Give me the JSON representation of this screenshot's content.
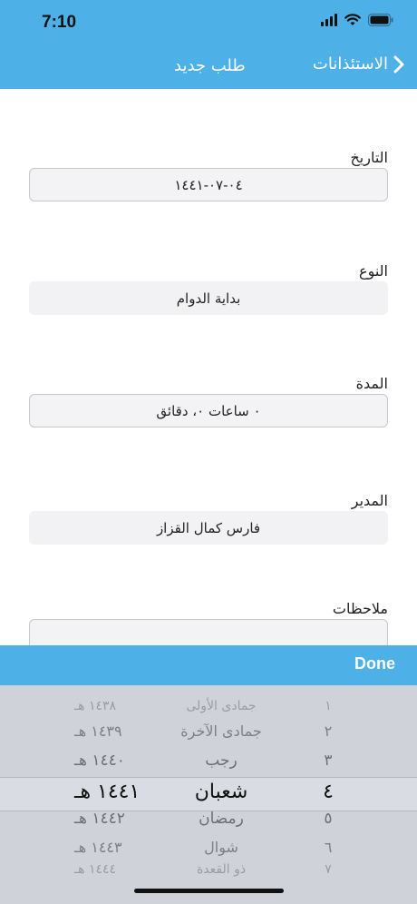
{
  "status": {
    "time": "7:10"
  },
  "nav": {
    "back_label": "الاستئذانات",
    "title": "طلب جديد"
  },
  "form": {
    "date_label": "التاريخ",
    "date_value": "٠٤-٠٧-١٤٤١",
    "type_label": "النوع",
    "type_value": "بداية الدوام",
    "duration_label": "المدة",
    "duration_value": "٠ ساعات ٠، دقائق",
    "manager_label": "المدير",
    "manager_value": "فارس كمال القزاز",
    "notes_label": "ملاحظات",
    "notes_value": ""
  },
  "picker": {
    "done_label": "Done",
    "rows": [
      {
        "year": "١٤٣٨ هـ",
        "month": "جمادى الأولى",
        "num": "١"
      },
      {
        "year": "١٤٣٩ هـ",
        "month": "جمادى الآخرة",
        "num": "٢"
      },
      {
        "year": "١٤٤٠ هـ",
        "month": "رجب",
        "num": "٣"
      },
      {
        "year": "١٤٤١ هـ",
        "month": "شعبان",
        "num": "٤"
      },
      {
        "year": "١٤٤٢ هـ",
        "month": "رمضان",
        "num": "٥"
      },
      {
        "year": "١٤٤٣ هـ",
        "month": "شوال",
        "num": "٦"
      },
      {
        "year": "١٤٤٤ هـ",
        "month": "ذو القعدة",
        "num": "٧"
      }
    ],
    "selected_index": 3
  }
}
